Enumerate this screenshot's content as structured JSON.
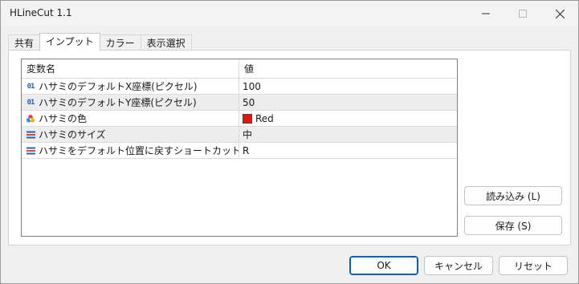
{
  "window": {
    "title": "HLineCut 1.1"
  },
  "tabs": [
    {
      "label": "共有"
    },
    {
      "label": "インプット"
    },
    {
      "label": "カラー"
    },
    {
      "label": "表示選択"
    }
  ],
  "grid": {
    "columns": {
      "name": "変数名",
      "value": "値"
    },
    "rows": [
      {
        "icon": "numeric-01-icon",
        "name": "ハサミのデフォルトX座標(ピクセル)",
        "value": "100"
      },
      {
        "icon": "numeric-01-icon",
        "name": "ハサミのデフォルトY座標(ピクセル)",
        "value": "50"
      },
      {
        "icon": "color-palette-icon",
        "name": "ハサミの色",
        "value": "Red",
        "swatch": "#e8130f"
      },
      {
        "icon": "enum-list-icon",
        "name": "ハサミのサイズ",
        "value": "中"
      },
      {
        "icon": "enum-list-icon",
        "name": "ハサミをデフォルト位置に戻すショートカットキー",
        "value": "R"
      }
    ]
  },
  "side_buttons": {
    "load": "読み込み (L)",
    "save": "保存 (S)"
  },
  "footer": {
    "ok": "OK",
    "cancel": "キャンセル",
    "reset": "リセット"
  },
  "colors": {
    "accent": "#005fb8",
    "row_alt": "#ededed",
    "swatch_red": "#e8130f"
  }
}
